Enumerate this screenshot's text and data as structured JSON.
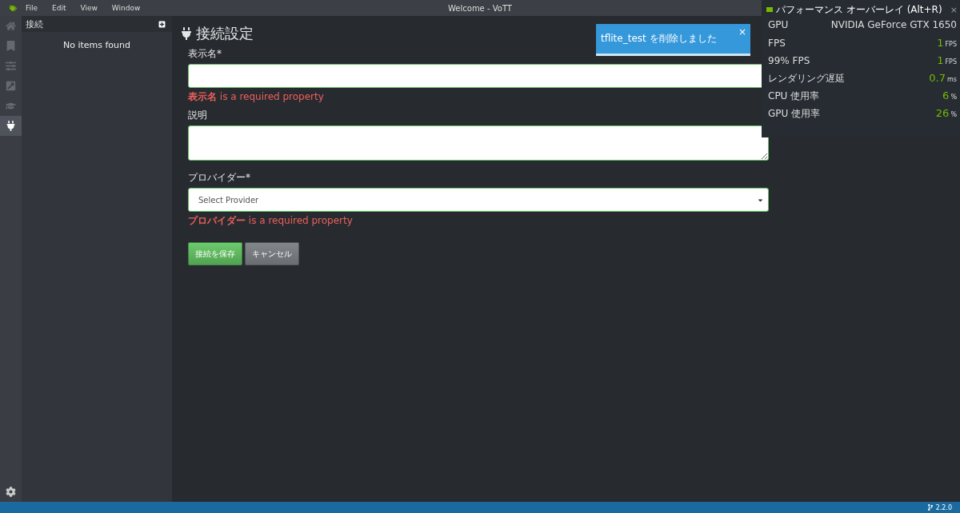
{
  "window": {
    "title": "Welcome - VoTT",
    "menu": [
      "File",
      "Edit",
      "View",
      "Window"
    ]
  },
  "nav": [
    {
      "kind": "home",
      "selected": false
    },
    {
      "kind": "bookmark",
      "selected": false
    },
    {
      "kind": "sliders",
      "selected": false
    },
    {
      "kind": "export",
      "selected": false
    },
    {
      "kind": "learn",
      "selected": false
    },
    {
      "kind": "plug",
      "selected": true
    }
  ],
  "sidebar": {
    "title": "接続",
    "empty": "No items found"
  },
  "form": {
    "title": "接続設定",
    "fields": [
      {
        "kind": "text",
        "label": "表示名*",
        "error": "**表示名** is a required property"
      },
      {
        "kind": "textarea",
        "label": "説明"
      },
      {
        "kind": "select",
        "label": "プロバイダー*",
        "placeholder": "Select Provider",
        "error": "**プロバイダー** is a required property"
      }
    ],
    "buttons": [
      {
        "kind": "primary",
        "label": "接続を保存"
      },
      {
        "kind": "secondary",
        "label": "キャンセル"
      }
    ]
  },
  "toast": {
    "message": "tflite_test を削除しました",
    "close": "×"
  },
  "overlay": {
    "title": "パフォーマンス オーバーレイ (Alt+R)",
    "close": "×",
    "gpu_label": "GPU",
    "gpu_name": "NVIDIA GeForce GTX 1650",
    "stats": [
      {
        "label": "FPS",
        "value": "1",
        "unit": "FPS"
      },
      {
        "label": "99% FPS",
        "value": "1",
        "unit": "FPS"
      },
      {
        "label": "レンダリング遅延",
        "value": "0.7",
        "unit": "ms"
      },
      {
        "label": "CPU 使用率",
        "value": "6",
        "unit": "%"
      },
      {
        "label": "GPU 使用率",
        "value": "26",
        "unit": "%"
      }
    ]
  },
  "status_bar": {
    "version": "2.2.0"
  }
}
